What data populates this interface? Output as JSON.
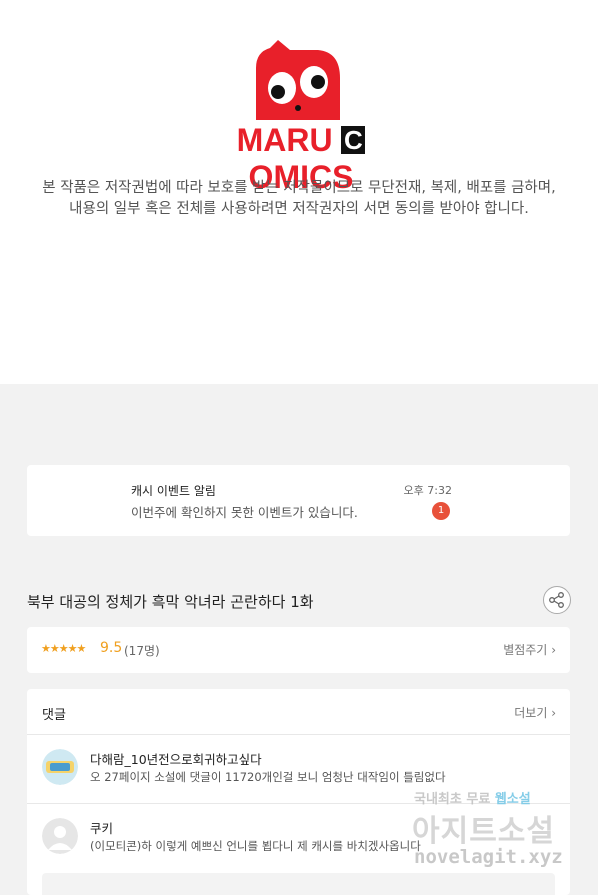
{
  "header": {
    "logo_text": "MARU COMICS",
    "notice_line1": "본 작품은 저작권법에 따라 보호를 받는 저작물이므로 무단전재, 복제,  배포를 금하며,",
    "notice_line2": "내용의 일부 혹은 전체를 사용하려면 저작권자의 서면 동의를 받아야 합니다."
  },
  "event": {
    "title": "캐시 이벤트 알림",
    "message": "이번주에 확인하지 못한 이벤트가 있습니다.",
    "time": "오후 7:32",
    "badge": "1"
  },
  "episode": {
    "title": "북부 대공의 정체가 흑막 악녀라 곤란하다 1화"
  },
  "rating": {
    "stars": "★★★★★",
    "score": "9.5",
    "count": "(17명)",
    "rate_label": "별점주기"
  },
  "comments": {
    "header": "댓글",
    "more_label": "더보기",
    "items": [
      {
        "name": "다해람_10년전으로회귀하고싶다",
        "body": "오 27페이지 소설에 댓글이 11720개인걸 보니 엄청난 대작임이 틀림없다"
      },
      {
        "name": "쿠키",
        "body": "(이모티콘)하 이렇게 예쁘신 언니를 뵙다니 제 캐시를 바치겠사옵니다"
      }
    ]
  },
  "watermark": {
    "line1_a": "국내최초 무료",
    "line1_b": "웹소설",
    "line2": "아지트소설",
    "line3": "novelagit.xyz"
  },
  "colors": {
    "brand_red": "#e8202a",
    "star": "#f0a020",
    "badge": "#e8513a",
    "background": "#f2f2f2"
  }
}
